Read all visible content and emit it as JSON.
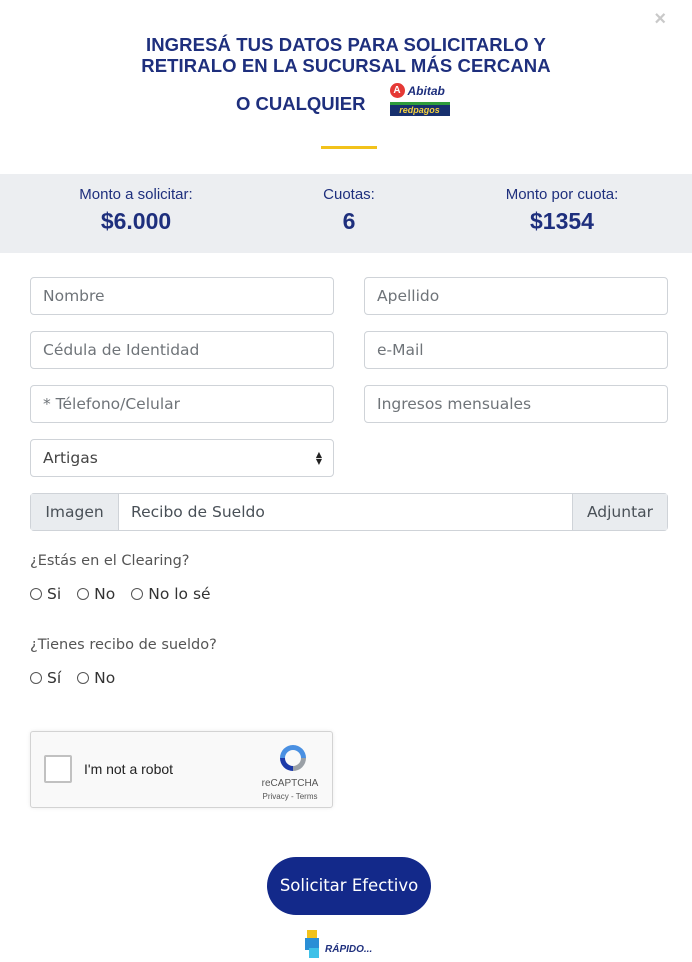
{
  "dialog": {
    "close_icon": "×"
  },
  "header": {
    "title_line1": "INGRESÁ TUS DATOS PARA SOLICITARLO Y",
    "title_line2": "RETIRALO EN LA SUCURSAL MÁS CERCANA",
    "title_line3": "O CUALQUIER",
    "abitab_logo_text": "Abitab",
    "redpagos_logo_text": "redpagos",
    "accent_color": "#f2c21b",
    "title_color": "#1e2f7d"
  },
  "summary": {
    "monto_label": "Monto a solicitar:",
    "monto_value": "$6.000",
    "cuotas_label": "Cuotas:",
    "cuotas_value": "6",
    "por_cuota_label": "Monto por cuota:",
    "por_cuota_value": "$1354"
  },
  "form": {
    "nombre_placeholder": "Nombre",
    "apellido_placeholder": "Apellido",
    "cedula_placeholder": "Cédula de Identidad",
    "email_placeholder": "e-Mail",
    "telefono_placeholder": "* Télefono/Celular",
    "ingresos_placeholder": "Ingresos mensuales",
    "departamento_selected": "Artigas",
    "upload": {
      "prefix": "Imagen",
      "value": "Recibo de Sueldo",
      "button": "Adjuntar"
    },
    "clearing": {
      "question": "¿Estás en el Clearing?",
      "options": [
        "Si",
        "No",
        "No lo sé"
      ]
    },
    "recibo": {
      "question": "¿Tienes recibo de sueldo?",
      "options": [
        "Sí",
        "No"
      ]
    },
    "captcha": {
      "label": "I'm not a robot",
      "brand": "reCAPTCHA",
      "terms": "Privacy - Terms"
    },
    "submit_label": "Solicitar Efectivo",
    "submit_color": "#13298a"
  },
  "footer": {
    "logo_text": "RÁPIDO..."
  }
}
